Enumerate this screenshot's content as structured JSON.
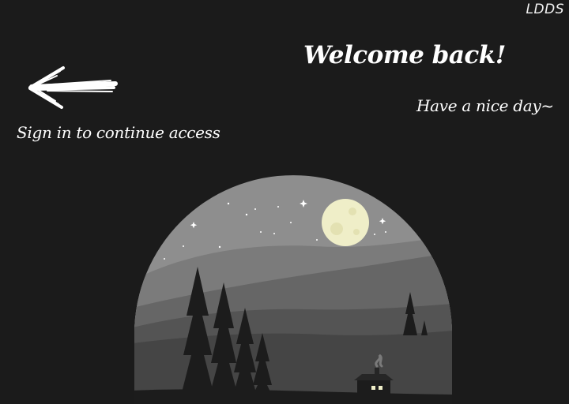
{
  "header": {
    "brand": "LDDS"
  },
  "greeting": {
    "title": "Welcome back!",
    "subtitle": "Have a nice day~"
  },
  "signin": {
    "prompt": "Sign in to continue access"
  },
  "icons": {
    "back": "arrow-left-icon"
  },
  "colors": {
    "background": "#1b1b1b",
    "text": "#ffffff",
    "moon": "#efeec8"
  }
}
